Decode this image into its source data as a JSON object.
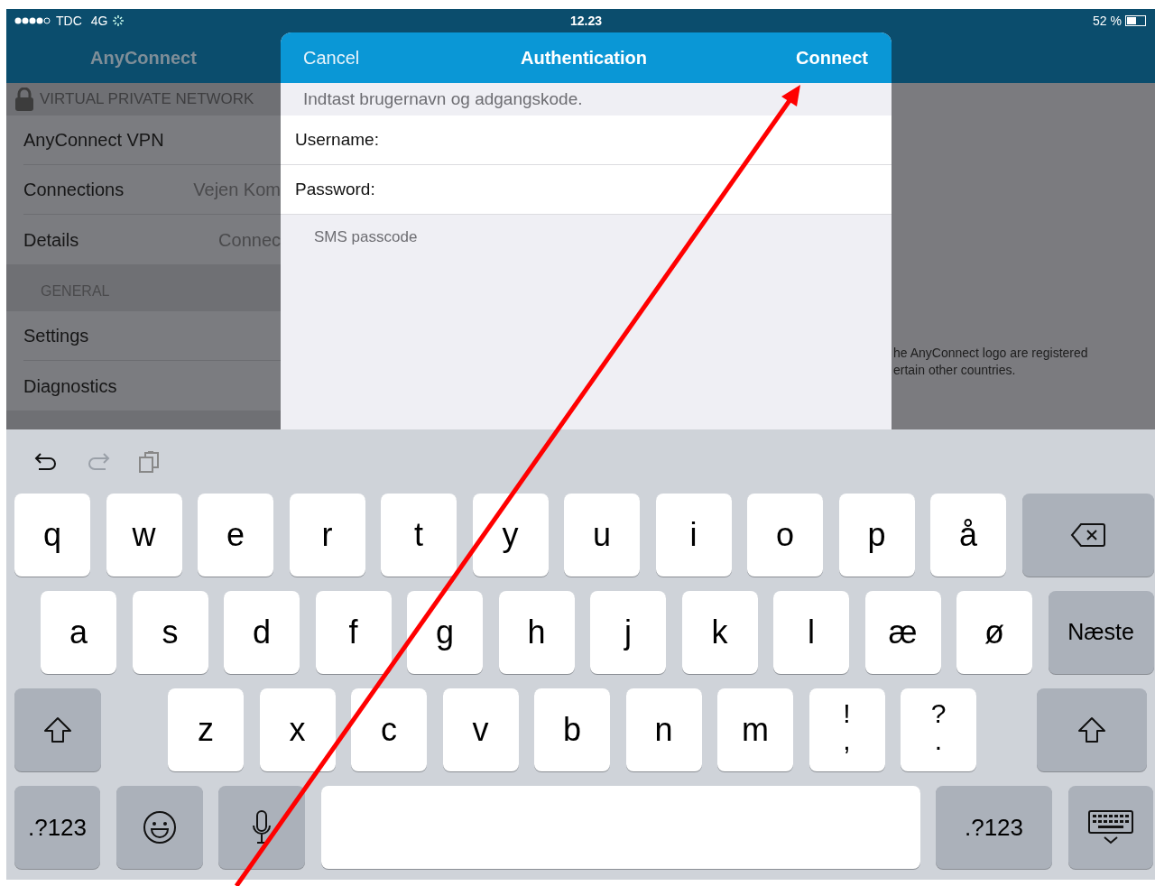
{
  "status_bar": {
    "carrier": "TDC",
    "network": "4G",
    "time": "12.23",
    "battery": "52 %"
  },
  "nav": {
    "title": "AnyConnect"
  },
  "sidebar": {
    "sections": [
      {
        "header": "VIRTUAL PRIVATE NETWORK",
        "lock": true,
        "items": [
          {
            "label": "AnyConnect VPN"
          },
          {
            "label": "Connections",
            "value": "Vejen Kom"
          },
          {
            "label": "Details",
            "value": "Connec"
          }
        ]
      },
      {
        "header": "GENERAL",
        "lock": false,
        "items": [
          {
            "label": "Settings"
          },
          {
            "label": "Diagnostics"
          }
        ]
      }
    ]
  },
  "background_text": [
    "he AnyConnect logo are registered",
    "ertain other countries."
  ],
  "dialog": {
    "cancel": "Cancel",
    "title": "Authentication",
    "connect": "Connect",
    "prompt": "Indtast brugernavn og adgangskode.",
    "fields": [
      {
        "label": "Username:"
      },
      {
        "label": "Password:"
      }
    ],
    "note": "SMS passcode"
  },
  "keyboard": {
    "rows": [
      {
        "keys": [
          {
            "kind": "letter",
            "label": "q"
          },
          {
            "kind": "letter",
            "label": "w"
          },
          {
            "kind": "letter",
            "label": "e"
          },
          {
            "kind": "letter",
            "label": "r"
          },
          {
            "kind": "letter",
            "label": "t"
          },
          {
            "kind": "letter",
            "label": "y"
          },
          {
            "kind": "letter",
            "label": "u"
          },
          {
            "kind": "letter",
            "label": "i"
          },
          {
            "kind": "letter",
            "label": "o"
          },
          {
            "kind": "letter",
            "label": "p"
          },
          {
            "kind": "letter",
            "label": "å"
          },
          {
            "kind": "backspace"
          }
        ]
      },
      {
        "keys": [
          {
            "kind": "letter",
            "label": "a"
          },
          {
            "kind": "letter",
            "label": "s"
          },
          {
            "kind": "letter",
            "label": "d"
          },
          {
            "kind": "letter",
            "label": "f"
          },
          {
            "kind": "letter",
            "label": "g"
          },
          {
            "kind": "letter",
            "label": "h"
          },
          {
            "kind": "letter",
            "label": "j"
          },
          {
            "kind": "letter",
            "label": "k"
          },
          {
            "kind": "letter",
            "label": "l"
          },
          {
            "kind": "letter",
            "label": "æ"
          },
          {
            "kind": "letter",
            "label": "ø"
          },
          {
            "kind": "next",
            "label": "Næste"
          }
        ]
      },
      {
        "keys": [
          {
            "kind": "shift"
          },
          {
            "kind": "letter",
            "label": "z"
          },
          {
            "kind": "letter",
            "label": "x"
          },
          {
            "kind": "letter",
            "label": "c"
          },
          {
            "kind": "letter",
            "label": "v"
          },
          {
            "kind": "letter",
            "label": "b"
          },
          {
            "kind": "letter",
            "label": "n"
          },
          {
            "kind": "letter",
            "label": "m"
          },
          {
            "kind": "dual",
            "label": "!",
            "sub": ","
          },
          {
            "kind": "dual",
            "label": "?",
            "sub": "."
          },
          {
            "kind": "shift"
          }
        ]
      },
      {
        "keys": [
          {
            "kind": "numbers",
            "label": ".?123"
          },
          {
            "kind": "emoji"
          },
          {
            "kind": "mic"
          },
          {
            "kind": "space"
          },
          {
            "kind": "numbers",
            "label": ".?123"
          },
          {
            "kind": "dismiss"
          }
        ]
      }
    ]
  }
}
